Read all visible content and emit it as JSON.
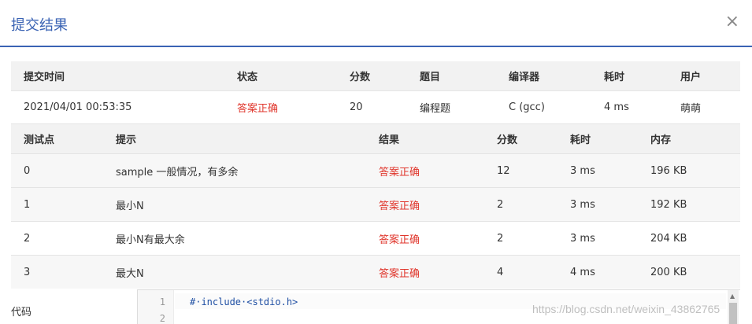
{
  "modal": {
    "title": "提交结果",
    "close_glyph": "×"
  },
  "summary": {
    "headers": [
      "提交时间",
      "状态",
      "分数",
      "题目",
      "编译器",
      "耗时",
      "用户"
    ],
    "row": [
      "2021/04/01 00:53:35",
      "答案正确",
      "20",
      "编程题",
      "C (gcc)",
      "4 ms",
      "萌萌"
    ]
  },
  "tests": {
    "headers": [
      "测试点",
      "提示",
      "结果",
      "分数",
      "耗时",
      "内存"
    ],
    "rows": [
      [
        "0",
        "sample 一般情况，有多余",
        "答案正确",
        "12",
        "3 ms",
        "196 KB"
      ],
      [
        "1",
        "最小N",
        "答案正确",
        "2",
        "3 ms",
        "192 KB"
      ],
      [
        "2",
        "最小N有最大余",
        "答案正确",
        "2",
        "3 ms",
        "204 KB"
      ],
      [
        "3",
        "最大N",
        "答案正确",
        "4",
        "4 ms",
        "200 KB"
      ]
    ]
  },
  "code": {
    "label": "代码",
    "line_numbers": [
      "1",
      "2"
    ],
    "lines": [
      "#·include·<stdio.h>",
      ""
    ]
  },
  "watermark": "https://blog.csdn.net/weixin_43862765",
  "colors": {
    "accent": "#3a63b4",
    "status_ok": "#e0362c"
  }
}
